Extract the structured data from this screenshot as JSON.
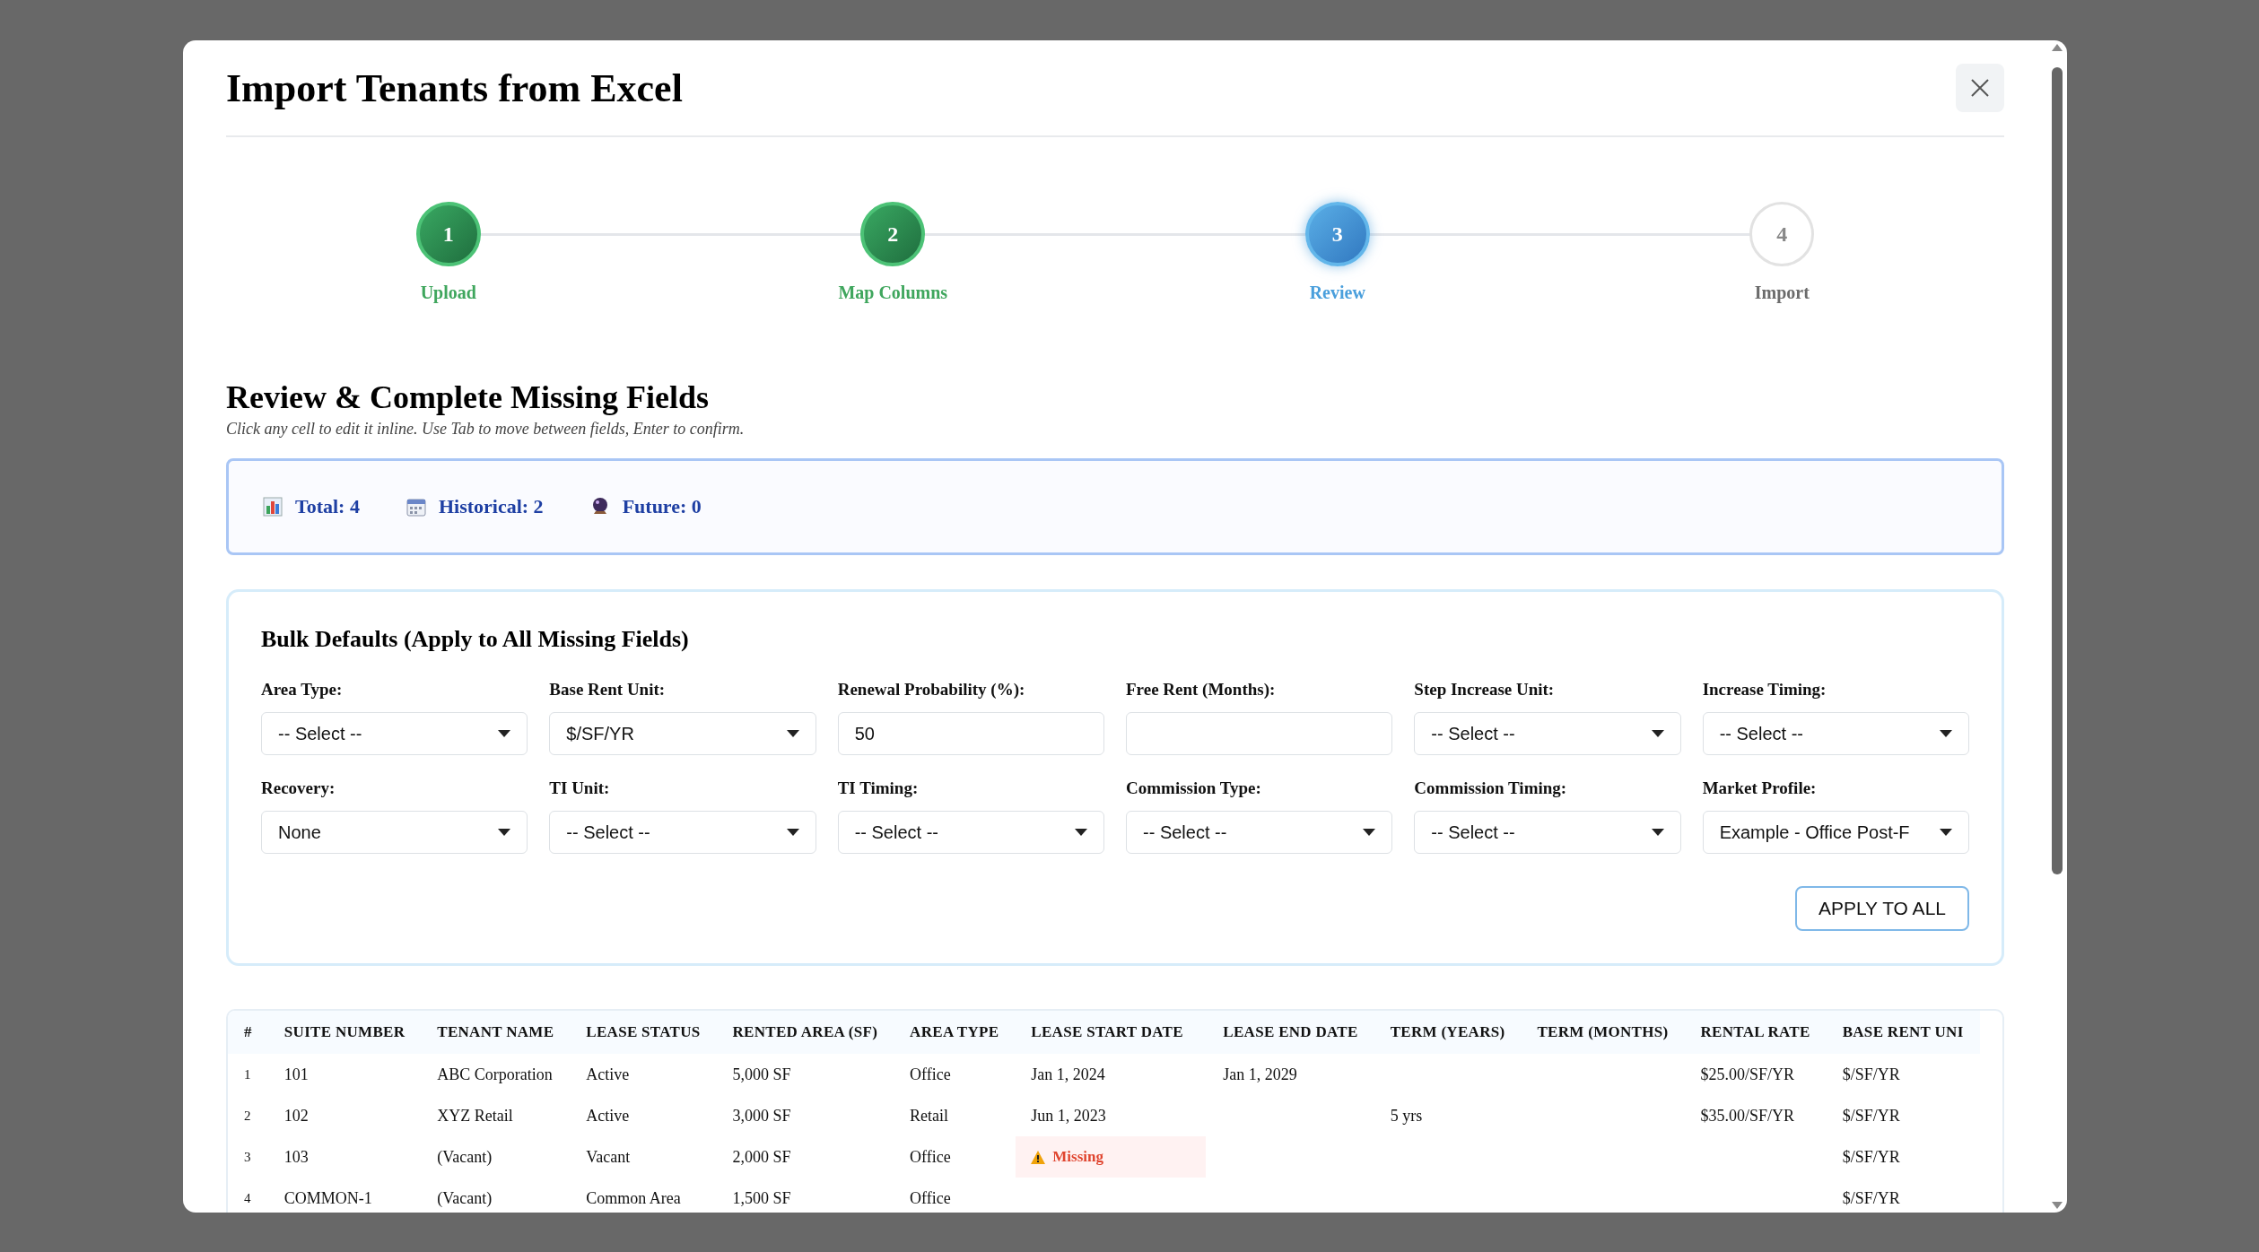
{
  "dialog": {
    "title": "Import Tenants from Excel"
  },
  "steps": [
    {
      "number": "1",
      "label": "Upload",
      "completed": true,
      "selected": false
    },
    {
      "number": "2",
      "label": "Map Columns",
      "completed": true,
      "selected": false
    },
    {
      "number": "3",
      "label": "Review",
      "completed": false,
      "selected": true
    },
    {
      "number": "4",
      "label": "Import",
      "completed": false,
      "selected": false
    }
  ],
  "section": {
    "title": "Review & Complete Missing Fields",
    "hint": "Click any cell to edit it inline. Use Tab to move between fields, Enter to confirm."
  },
  "stats": [
    {
      "kind": "chart",
      "text": "Total: 4"
    },
    {
      "kind": "calendar",
      "text": "Historical: 2"
    },
    {
      "kind": "globe",
      "text": "Future: 0"
    }
  ],
  "bulk_defaults": {
    "title": "Bulk Defaults (Apply to All Missing Fields)",
    "fields": [
      {
        "kind": "select",
        "label": "Area Type:",
        "value": "-- Select --"
      },
      {
        "kind": "select",
        "label": "Base Rent Unit:",
        "value": "$/SF/YR"
      },
      {
        "kind": "input",
        "label": "Renewal Probability (%):",
        "value": "50"
      },
      {
        "kind": "input",
        "label": "Free Rent (Months):"
      },
      {
        "kind": "select",
        "label": "Step Increase Unit:",
        "value": "-- Select --"
      },
      {
        "kind": "select",
        "label": "Increase Timing:",
        "value": "-- Select --"
      },
      {
        "kind": "select",
        "label": "Recovery:",
        "value": "None"
      },
      {
        "kind": "select",
        "label": "TI Unit:",
        "value": "-- Select --"
      },
      {
        "kind": "select",
        "label": "TI Timing:",
        "value": "-- Select --"
      },
      {
        "kind": "select",
        "label": "Commission Type:",
        "value": "-- Select --"
      },
      {
        "kind": "select",
        "label": "Commission Timing:",
        "value": "-- Select --"
      },
      {
        "kind": "select",
        "label": "Market Profile:",
        "value": "Example - Office Post-F"
      }
    ],
    "button": "APPLY TO ALL"
  },
  "table": {
    "columns": [
      "#",
      "SUITE NUMBER",
      "TENANT NAME",
      "LEASE STATUS",
      "RENTED AREA (SF)",
      "AREA TYPE",
      "LEASE START DATE",
      "LEASE END DATE",
      "TERM (YEARS)",
      "TERM (MONTHS)",
      "RENTAL RATE",
      "BASE RENT UNI"
    ],
    "rows": [
      [
        "1",
        "101",
        "ABC Corporation",
        "Active",
        "5,000 SF",
        "Office",
        "Jan 1, 2024",
        "Jan 1, 2029",
        null,
        null,
        "$25.00/SF/YR",
        "$/SF/YR"
      ],
      [
        "2",
        "102",
        "XYZ Retail",
        "Active",
        "3,000 SF",
        "Retail",
        "Jun 1, 2023",
        null,
        "5 yrs",
        null,
        "$35.00/SF/YR",
        "$/SF/YR"
      ],
      [
        "3",
        "103",
        "(Vacant)",
        "Vacant",
        "2,000 SF",
        "Office",
        {
          "kind": "missing",
          "text": "Missing"
        },
        null,
        null,
        null,
        null,
        "$/SF/YR"
      ],
      [
        "4",
        "COMMON-1",
        "(Vacant)",
        "Common Area",
        "1,500 SF",
        "Office",
        null,
        null,
        null,
        null,
        null,
        "$/SF/YR"
      ]
    ]
  }
}
